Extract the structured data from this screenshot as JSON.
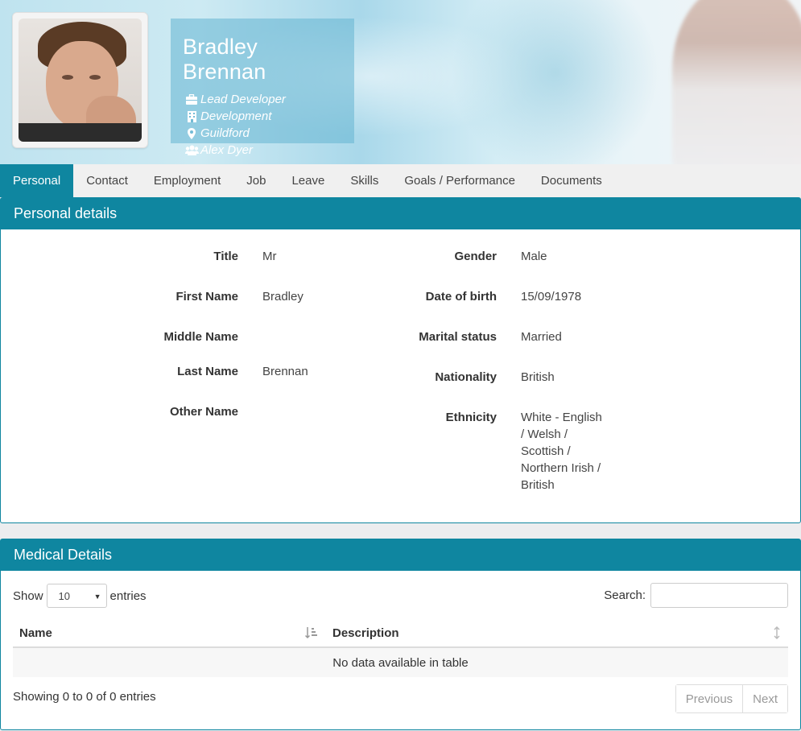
{
  "profile": {
    "name": "Bradley Brennan",
    "job_title": "Lead Developer",
    "department": "Development",
    "location": "Guildford",
    "manager": "Alex Dyer"
  },
  "tabs": [
    {
      "label": "Personal",
      "active": true
    },
    {
      "label": "Contact"
    },
    {
      "label": "Employment"
    },
    {
      "label": "Job"
    },
    {
      "label": "Leave"
    },
    {
      "label": "Skills"
    },
    {
      "label": "Goals / Performance"
    },
    {
      "label": "Documents"
    }
  ],
  "personal": {
    "heading": "Personal details",
    "title_label": "Title",
    "title_value": "Mr",
    "first_name_label": "First Name",
    "first_name_value": "Bradley",
    "middle_name_label": "Middle Name",
    "middle_name_value": "",
    "last_name_label": "Last Name",
    "last_name_value": "Brennan",
    "other_name_label": "Other Name",
    "other_name_value": "",
    "gender_label": "Gender",
    "gender_value": "Male",
    "dob_label": "Date of birth",
    "dob_value": "15/09/1978",
    "marital_label": "Marital status",
    "marital_value": "Married",
    "nationality_label": "Nationality",
    "nationality_value": "British",
    "ethnicity_label": "Ethnicity",
    "ethnicity_lines": [
      "White - English",
      "/ Welsh /",
      "Scottish /",
      "Northern Irish /",
      "British"
    ]
  },
  "medical": {
    "heading": "Medical Details",
    "show_label": "Show",
    "entries_label": "entries",
    "page_size": "10",
    "search_label": "Search:",
    "columns": [
      "Name",
      "Description"
    ],
    "empty_message": "No data available in table",
    "info": "Showing 0 to 0 of 0 entries",
    "previous": "Previous",
    "next": "Next"
  },
  "icons": {
    "job": "briefcase-icon",
    "department": "building-icon",
    "location": "map-marker-icon",
    "manager": "users-icon"
  },
  "colors": {
    "accent": "#0f86a0"
  }
}
